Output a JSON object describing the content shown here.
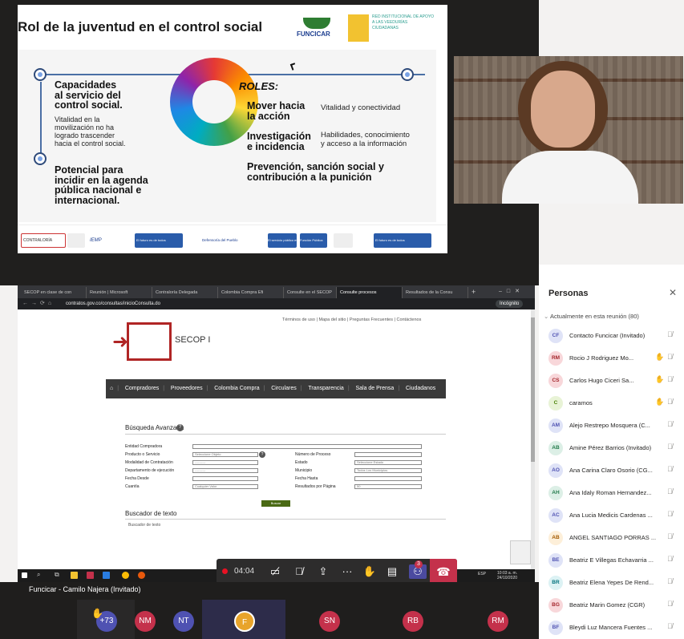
{
  "slide": {
    "title": "Rol de la juventud en el control social",
    "funcicar_logo": "FUNCICAR",
    "red_logo_text": "RED INSTITUCIONAL DE APOYO A LAS VEEDURÍAS CIUDADANAS",
    "left_heading_1": "Capacidades\nal servicio del\ncontrol social.",
    "left_text_1": "Vitalidad en la\nmovilización no ha\nlogrado trascender\nhacia el control social.",
    "left_heading_2": "Potencial para\nincidir en la agenda\npública nacional e\ninternacional.",
    "roles_label": "ROLES:",
    "role_1": "Mover hacia\nla acción",
    "role_1_desc": "Vitalidad y conectividad",
    "role_2": "Investigación\ne incidencia",
    "role_2_desc": "Habilidades, conocimiento\ny acceso a la información",
    "role_3": "Prevención, sanción social y\ncontribución a la punición",
    "footer_logos": [
      "CONTRALORÍA",
      "IEMP",
      "El futuro es de todos",
      "Defensoría del Pueblo",
      "El servicio público es de todos",
      "Función Pública",
      "El futuro es de todos"
    ]
  },
  "browser": {
    "tabs": [
      "SECOP en clase de con",
      "Reunión | Microsoft",
      "Contraloría Delegada",
      "Colombia Compra Efi",
      "Consulte en el SECOP",
      "Consulte procesos",
      "Resultados de la Consu"
    ],
    "url": "contratos.gov.co/consultas/inicioConsulta.do",
    "incognito": "Incógnito",
    "top_links": "Términos de uso  |  Mapa del sitio  |  Preguntas Frecuentes  |  Contáctenos",
    "site_name": "SECOP I",
    "nav_items": [
      "Compradores",
      "Proveedores",
      "Colombia Compra",
      "Circulares",
      "Transparencia",
      "Sala de Prensa",
      "Ciudadanos"
    ],
    "form_title": "Búsqueda Avanzada",
    "fields": {
      "entidad": "Entidad Compradora",
      "producto": "Producto o Servicio",
      "producto_value": "Seleccione Objeto",
      "modalidad": "Modalidad de Contratación",
      "modalidad_value": "----------",
      "departamento": "Departamento de ejecución",
      "departamento_value": "----------",
      "fecha_desde": "Fecha Desde",
      "cuantia": "Cuantía",
      "cuantia_value": "Cualquier Valor",
      "numero": "Número de Proceso",
      "estado": "Estado",
      "estado_value": "Seleccione Estado",
      "municipio": "Municipio",
      "municipio_value": "Todos Los Municipios",
      "fecha_hasta": "Fecha Hasta",
      "resultados": "Resultados por Página",
      "resultados_value": "50"
    },
    "search_button": "Buscar",
    "text_search_title": "Buscador de texto",
    "text_search_placeholder": "Buscador de texto",
    "clock": "10:03 a. m.\n24/10/2020",
    "lang": "ESP"
  },
  "callbar": {
    "time": "04:04",
    "badge": "3"
  },
  "strip": {
    "presenter": "Funcicar - Camilo Najera (Invitado)",
    "participants": [
      "+73",
      "NM",
      "NT",
      "F",
      "SN",
      "RB",
      "RM"
    ]
  },
  "panel": {
    "title": "Personas",
    "subtitle": "Actualmente en esta reunión (80)",
    "people": [
      {
        "initials": "CF",
        "name": "Contacto Funcicar (Invitado)",
        "hand": false,
        "bg": "#dfe3f7",
        "fg": "#4f52b2"
      },
      {
        "initials": "RM",
        "name": "Rocio J Rodriguez Mo...",
        "hand": true,
        "bg": "#f8d7da",
        "fg": "#a4262c"
      },
      {
        "initials": "CS",
        "name": "Carlos Hugo Ciceri Sa...",
        "hand": true,
        "bg": "#f8d7da",
        "fg": "#a4262c"
      },
      {
        "initials": "C",
        "name": "caramos",
        "hand": true,
        "bg": "#e8f3d6",
        "fg": "#498205"
      },
      {
        "initials": "AM",
        "name": "Alejo Restrepo Mosquera (C...",
        "hand": false,
        "bg": "#dfe3f7",
        "fg": "#4f52b2"
      },
      {
        "initials": "AB",
        "name": "Amine Pérez Barrios (Invitado)",
        "hand": false,
        "bg": "#dcefe6",
        "fg": "#237b4b"
      },
      {
        "initials": "AO",
        "name": "Ana Carina Claro Osorio (CG...",
        "hand": false,
        "bg": "#dfe3f7",
        "fg": "#4f52b2"
      },
      {
        "initials": "AH",
        "name": "Ana Idaly Roman Hernandez...",
        "hand": false,
        "bg": "#dcefe6",
        "fg": "#237b4b"
      },
      {
        "initials": "AC",
        "name": "Ana Lucia Medicis Cardenas ...",
        "hand": false,
        "bg": "#dfe3f7",
        "fg": "#4f52b2"
      },
      {
        "initials": "AB",
        "name": "ANGEL SANTIAGO PORRAS ...",
        "hand": false,
        "bg": "#fdefd9",
        "fg": "#a45a00"
      },
      {
        "initials": "BE",
        "name": "Beatriz E Villegas Echavarria ...",
        "hand": false,
        "bg": "#dfe3f7",
        "fg": "#4f52b2"
      },
      {
        "initials": "BR",
        "name": "Beatriz Elena Yepes De Rend...",
        "hand": false,
        "bg": "#dcf2f4",
        "fg": "#00727d"
      },
      {
        "initials": "BG",
        "name": "Beatriz Marin Gomez (CGR)",
        "hand": false,
        "bg": "#f8d7da",
        "fg": "#a4262c"
      },
      {
        "initials": "BF",
        "name": "Bleydi Luz Mancera Fuentes ...",
        "hand": false,
        "bg": "#dfe3f7",
        "fg": "#4f52b2"
      }
    ]
  }
}
